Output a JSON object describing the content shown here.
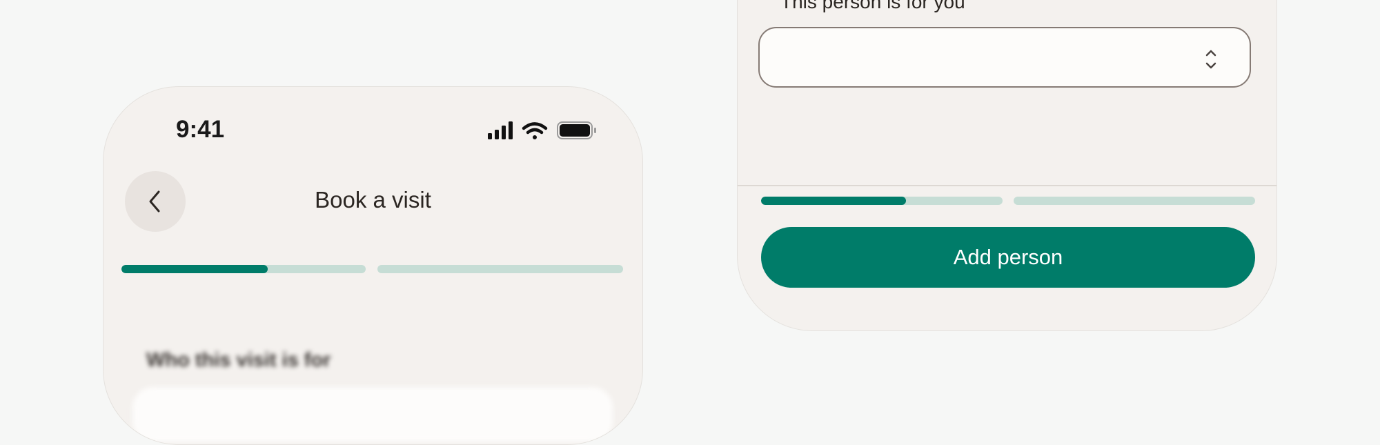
{
  "left_screen": {
    "status_bar": {
      "time": "9:41",
      "icons": [
        "cellular-signal-icon",
        "wifi-icon",
        "battery-icon"
      ]
    },
    "header": {
      "back_icon": "chevron-left-icon",
      "title": "Book a visit"
    },
    "steps": [
      {
        "progress": 0.6
      },
      {
        "progress": 0.0
      }
    ],
    "blurred_section_label": "Who this visit is for"
  },
  "right_screen": {
    "field_label": "This person is for you",
    "select": {
      "value": "",
      "icon": "chevron-up-down-icon"
    },
    "steps": [
      {
        "progress": 0.6
      },
      {
        "progress": 0.0
      }
    ],
    "primary_button_label": "Add person"
  },
  "colors": {
    "accent": "#007c69",
    "track": "#c6ddd5",
    "surface": "#f4f1ee",
    "background": "#f6f7f6"
  }
}
